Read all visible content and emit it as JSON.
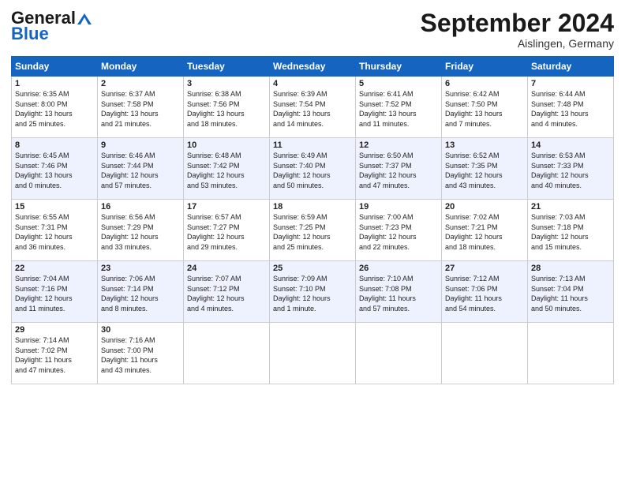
{
  "header": {
    "logo_text_general": "General",
    "logo_text_blue": "Blue",
    "month_title": "September 2024",
    "location": "Aislingen, Germany"
  },
  "calendar": {
    "headers": [
      "Sunday",
      "Monday",
      "Tuesday",
      "Wednesday",
      "Thursday",
      "Friday",
      "Saturday"
    ],
    "weeks": [
      [
        {
          "day": "",
          "info": ""
        },
        {
          "day": "2",
          "info": "Sunrise: 6:37 AM\nSunset: 7:58 PM\nDaylight: 13 hours\nand 21 minutes."
        },
        {
          "day": "3",
          "info": "Sunrise: 6:38 AM\nSunset: 7:56 PM\nDaylight: 13 hours\nand 18 minutes."
        },
        {
          "day": "4",
          "info": "Sunrise: 6:39 AM\nSunset: 7:54 PM\nDaylight: 13 hours\nand 14 minutes."
        },
        {
          "day": "5",
          "info": "Sunrise: 6:41 AM\nSunset: 7:52 PM\nDaylight: 13 hours\nand 11 minutes."
        },
        {
          "day": "6",
          "info": "Sunrise: 6:42 AM\nSunset: 7:50 PM\nDaylight: 13 hours\nand 7 minutes."
        },
        {
          "day": "7",
          "info": "Sunrise: 6:44 AM\nSunset: 7:48 PM\nDaylight: 13 hours\nand 4 minutes."
        }
      ],
      [
        {
          "day": "1",
          "info": "Sunrise: 6:35 AM\nSunset: 8:00 PM\nDaylight: 13 hours\nand 25 minutes."
        },
        {
          "day": "",
          "info": ""
        },
        {
          "day": "",
          "info": ""
        },
        {
          "day": "",
          "info": ""
        },
        {
          "day": "",
          "info": ""
        },
        {
          "day": "",
          "info": ""
        },
        {
          "day": "",
          "info": ""
        }
      ],
      [
        {
          "day": "8",
          "info": "Sunrise: 6:45 AM\nSunset: 7:46 PM\nDaylight: 13 hours\nand 0 minutes."
        },
        {
          "day": "9",
          "info": "Sunrise: 6:46 AM\nSunset: 7:44 PM\nDaylight: 12 hours\nand 57 minutes."
        },
        {
          "day": "10",
          "info": "Sunrise: 6:48 AM\nSunset: 7:42 PM\nDaylight: 12 hours\nand 53 minutes."
        },
        {
          "day": "11",
          "info": "Sunrise: 6:49 AM\nSunset: 7:40 PM\nDaylight: 12 hours\nand 50 minutes."
        },
        {
          "day": "12",
          "info": "Sunrise: 6:50 AM\nSunset: 7:37 PM\nDaylight: 12 hours\nand 47 minutes."
        },
        {
          "day": "13",
          "info": "Sunrise: 6:52 AM\nSunset: 7:35 PM\nDaylight: 12 hours\nand 43 minutes."
        },
        {
          "day": "14",
          "info": "Sunrise: 6:53 AM\nSunset: 7:33 PM\nDaylight: 12 hours\nand 40 minutes."
        }
      ],
      [
        {
          "day": "15",
          "info": "Sunrise: 6:55 AM\nSunset: 7:31 PM\nDaylight: 12 hours\nand 36 minutes."
        },
        {
          "day": "16",
          "info": "Sunrise: 6:56 AM\nSunset: 7:29 PM\nDaylight: 12 hours\nand 33 minutes."
        },
        {
          "day": "17",
          "info": "Sunrise: 6:57 AM\nSunset: 7:27 PM\nDaylight: 12 hours\nand 29 minutes."
        },
        {
          "day": "18",
          "info": "Sunrise: 6:59 AM\nSunset: 7:25 PM\nDaylight: 12 hours\nand 25 minutes."
        },
        {
          "day": "19",
          "info": "Sunrise: 7:00 AM\nSunset: 7:23 PM\nDaylight: 12 hours\nand 22 minutes."
        },
        {
          "day": "20",
          "info": "Sunrise: 7:02 AM\nSunset: 7:21 PM\nDaylight: 12 hours\nand 18 minutes."
        },
        {
          "day": "21",
          "info": "Sunrise: 7:03 AM\nSunset: 7:18 PM\nDaylight: 12 hours\nand 15 minutes."
        }
      ],
      [
        {
          "day": "22",
          "info": "Sunrise: 7:04 AM\nSunset: 7:16 PM\nDaylight: 12 hours\nand 11 minutes."
        },
        {
          "day": "23",
          "info": "Sunrise: 7:06 AM\nSunset: 7:14 PM\nDaylight: 12 hours\nand 8 minutes."
        },
        {
          "day": "24",
          "info": "Sunrise: 7:07 AM\nSunset: 7:12 PM\nDaylight: 12 hours\nand 4 minutes."
        },
        {
          "day": "25",
          "info": "Sunrise: 7:09 AM\nSunset: 7:10 PM\nDaylight: 12 hours\nand 1 minute."
        },
        {
          "day": "26",
          "info": "Sunrise: 7:10 AM\nSunset: 7:08 PM\nDaylight: 11 hours\nand 57 minutes."
        },
        {
          "day": "27",
          "info": "Sunrise: 7:12 AM\nSunset: 7:06 PM\nDaylight: 11 hours\nand 54 minutes."
        },
        {
          "day": "28",
          "info": "Sunrise: 7:13 AM\nSunset: 7:04 PM\nDaylight: 11 hours\nand 50 minutes."
        }
      ],
      [
        {
          "day": "29",
          "info": "Sunrise: 7:14 AM\nSunset: 7:02 PM\nDaylight: 11 hours\nand 47 minutes."
        },
        {
          "day": "30",
          "info": "Sunrise: 7:16 AM\nSunset: 7:00 PM\nDaylight: 11 hours\nand 43 minutes."
        },
        {
          "day": "",
          "info": ""
        },
        {
          "day": "",
          "info": ""
        },
        {
          "day": "",
          "info": ""
        },
        {
          "day": "",
          "info": ""
        },
        {
          "day": "",
          "info": ""
        }
      ]
    ]
  }
}
